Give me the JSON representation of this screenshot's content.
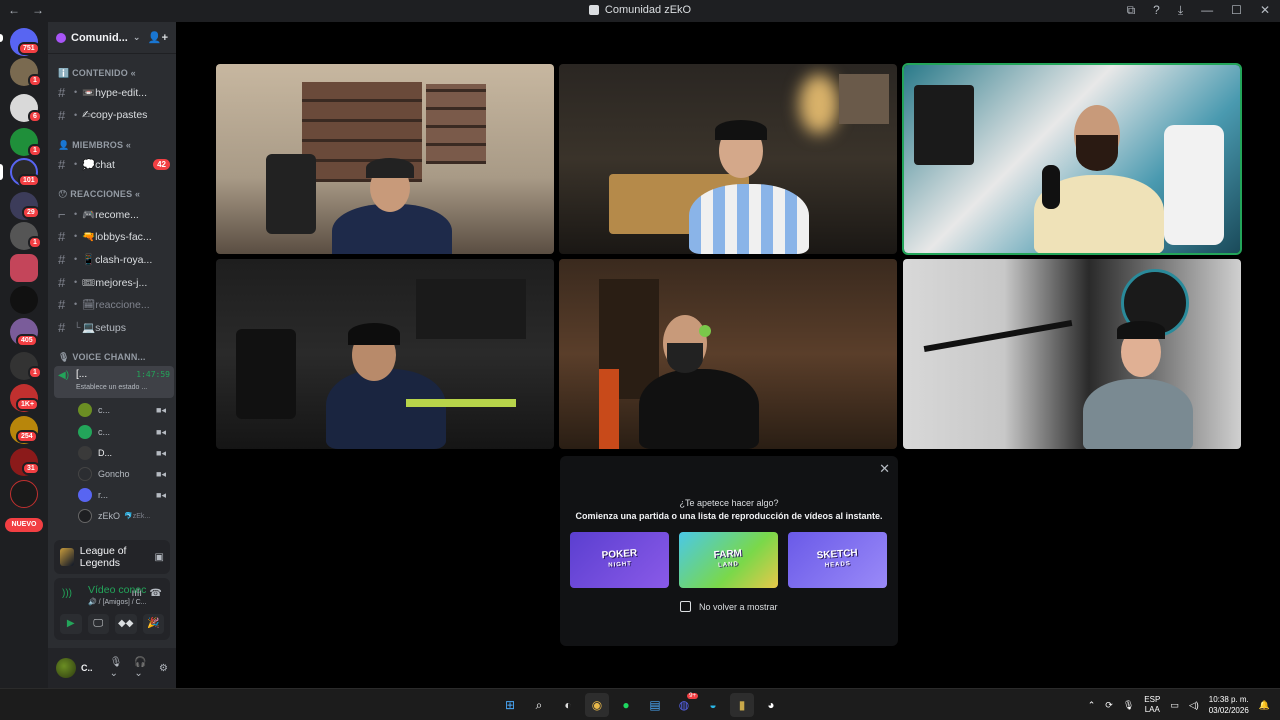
{
  "window": {
    "title": "Comunidad zEkO",
    "nav_back": "←",
    "nav_forward": "→",
    "controls": [
      "⧉",
      "?",
      "⤓",
      "—",
      "☐",
      "✕"
    ]
  },
  "rail": {
    "badges": [
      {
        "label": "751"
      },
      {
        "label": "1"
      },
      {
        "label": "6"
      },
      {
        "label": "1"
      },
      {
        "label": "101"
      },
      {
        "label": "29"
      },
      {
        "label": "1"
      },
      {
        "label": "405"
      },
      {
        "label": "1"
      },
      {
        "label": "1K+"
      },
      {
        "label": "254"
      },
      {
        "label": "31"
      }
    ],
    "nuevo": "NUEVO"
  },
  "guild": {
    "name": "Comunid...",
    "caret": "⌄",
    "add_user": "👤+"
  },
  "categories": {
    "contenido": "ℹ️ CONTENIDO «",
    "miembros": "👤 MIEMBROS «",
    "reacciones": "😯 REACCIONES «",
    "voice": "🎙 VOICE CHANN..."
  },
  "channels": {
    "hype": "📼hype-edit...",
    "copy": "✍copy-pastes",
    "chat": "💭chat",
    "chat_count": "42",
    "recome": "🎮recome...",
    "lobbys": "🔫lobbys-fac...",
    "clash": "📱clash-roya...",
    "mejores": "🎟mejores-j...",
    "reacciones": "🗓reaccione...",
    "setups": "💻setups"
  },
  "voice_channel": {
    "name": "[...",
    "time": "1:47:59",
    "status": "Establece un estado ..."
  },
  "voice_users": [
    {
      "name": "c...",
      "color": "#6b8e23"
    },
    {
      "name": "c...",
      "color": "#23a55a"
    },
    {
      "name": "D...",
      "color": "#3a3a3a"
    },
    {
      "name": "Goncho",
      "color": "#2b2d31"
    },
    {
      "name": "r...",
      "color": "#5865f2"
    },
    {
      "name": "zEkO",
      "color": "#1e1f22"
    }
  ],
  "voice_user_tag": "🐬zEk...",
  "game": {
    "title": "League of Legends"
  },
  "voice_panel": {
    "title": "Vídeo conectado",
    "subtitle": "🔊 / [Amigos] / C...",
    "btn_cam": "▶",
    "btn_screen": "🖵",
    "btn_activity": "◆◆",
    "btn_sound": "🎉"
  },
  "user": {
    "name": "C...",
    "mic": "🎙 ⌄",
    "headset": "🎧 ⌄",
    "settings": "⚙"
  },
  "popup": {
    "close": "✕",
    "question": "¿Te apetece hacer algo?",
    "subtitle": "Comienza una partida o una lista de reproducción de vídeos al instante.",
    "checkbox_label": "No volver a mostrar",
    "activities": [
      {
        "top": "POKER",
        "bottom": "NIGHT"
      },
      {
        "top": "FARM",
        "bottom": "LAND"
      },
      {
        "top": "SKETCH",
        "bottom": "HEADS"
      }
    ]
  },
  "taskbar": {
    "lang": "ESP",
    "region": "LAA",
    "time": "10:38 p. m.",
    "date": "03/02/2026",
    "discord_badge": "9+"
  },
  "colors": {
    "accent_green": "#23a55a",
    "badge_red": "#f23f43",
    "sidebar_bg": "#2b2d31",
    "rail_bg": "#1e1f22"
  }
}
